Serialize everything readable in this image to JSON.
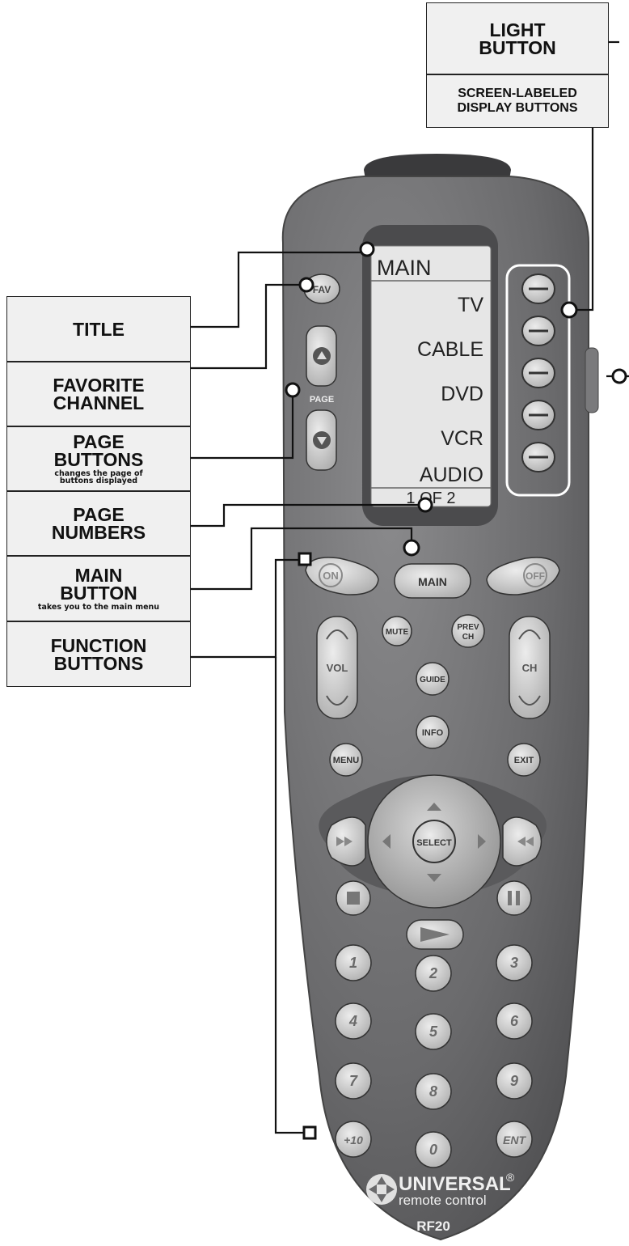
{
  "callouts": {
    "light": "LIGHT\nBUTTON",
    "screen_labeled": "SCREEN-LABELED\nDISPLAY BUTTONS",
    "title": "TITLE",
    "favorite": "FAVORITE\nCHANNEL",
    "page_buttons": "PAGE\nBUTTONS",
    "page_buttons_sub": "changes the page of\nbuttons displayed",
    "page_numbers": "PAGE\nNUMBERS",
    "main_button": "MAIN\nBUTTON",
    "main_button_sub": "takes you to the main menu",
    "function_buttons": "FUNCTION\nBUTTONS"
  },
  "lcd": {
    "title": "MAIN",
    "items": [
      "TV",
      "CABLE",
      "DVD",
      "VCR",
      "AUDIO"
    ],
    "page": "1 OF 2"
  },
  "remote": {
    "fav": "FAV",
    "page": "PAGE",
    "on": "ON",
    "main": "MAIN",
    "off": "OFF",
    "mute": "MUTE",
    "prev_ch": [
      "PREV",
      "CH"
    ],
    "vol": "VOL",
    "ch": "CH",
    "guide": "GUIDE",
    "info": "INFO",
    "menu": "MENU",
    "exit": "EXIT",
    "select": "SELECT",
    "digits": [
      "1",
      "2",
      "3",
      "4",
      "5",
      "6",
      "7",
      "8",
      "9",
      "+10",
      "0",
      "ENT"
    ],
    "brand": "UNIVERSAL",
    "brand_sub": "remote control",
    "model": "RF20",
    "reg": "®"
  },
  "colors": {
    "body": "#6e6e70",
    "button": "#cfcfcf",
    "lcd": "#e6e6e6",
    "callout": "#f0f0f0"
  }
}
